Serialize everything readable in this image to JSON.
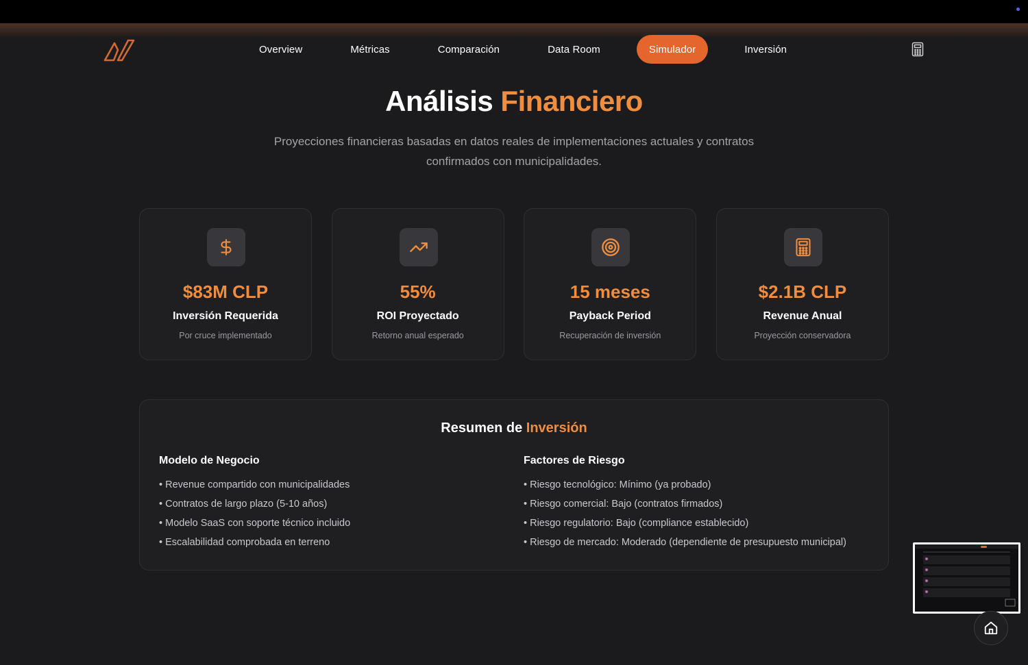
{
  "nav": {
    "items": [
      {
        "label": "Overview"
      },
      {
        "label": "Métricas"
      },
      {
        "label": "Comparación"
      },
      {
        "label": "Data Room"
      },
      {
        "label": "Simulador"
      },
      {
        "label": "Inversión"
      }
    ],
    "active": "Simulador"
  },
  "header": {
    "title_main": "Análisis",
    "title_accent": "Financiero",
    "subtitle": "Proyecciones financieras basadas en datos reales de implementaciones actuales y contratos confirmados con municipalidades."
  },
  "cards": [
    {
      "icon": "dollar-icon",
      "value": "$83M CLP",
      "label": "Inversión Requerida",
      "sub": "Por cruce implementado"
    },
    {
      "icon": "trending-up-icon",
      "value": "55%",
      "label": "ROI Proyectado",
      "sub": "Retorno anual esperado"
    },
    {
      "icon": "target-icon",
      "value": "15 meses",
      "label": "Payback Period",
      "sub": "Recuperación de inversión"
    },
    {
      "icon": "calculator-icon",
      "value": "$2.1B CLP",
      "label": "Revenue Anual",
      "sub": "Proyección conservadora"
    }
  ],
  "summary": {
    "title_main": "Resumen de",
    "title_accent": "Inversión",
    "left": {
      "title": "Modelo de Negocio",
      "items": [
        "Revenue compartido con municipalidades",
        "Contratos de largo plazo (5-10 años)",
        "Modelo SaaS con soporte técnico incluido",
        "Escalabilidad comprobada en terreno"
      ]
    },
    "right": {
      "title": "Factores de Riesgo",
      "items": [
        "Riesgo tecnológico: Mínimo (ya probado)",
        "Riesgo comercial: Bajo (contratos firmados)",
        "Riesgo regulatorio: Bajo (compliance establecido)",
        "Riesgo de mercado: Moderado (dependiente de presupuesto municipal)"
      ]
    }
  },
  "colors": {
    "accent": "#f08d3e",
    "active_nav": "#e4662c",
    "background": "#1b1b1d"
  }
}
